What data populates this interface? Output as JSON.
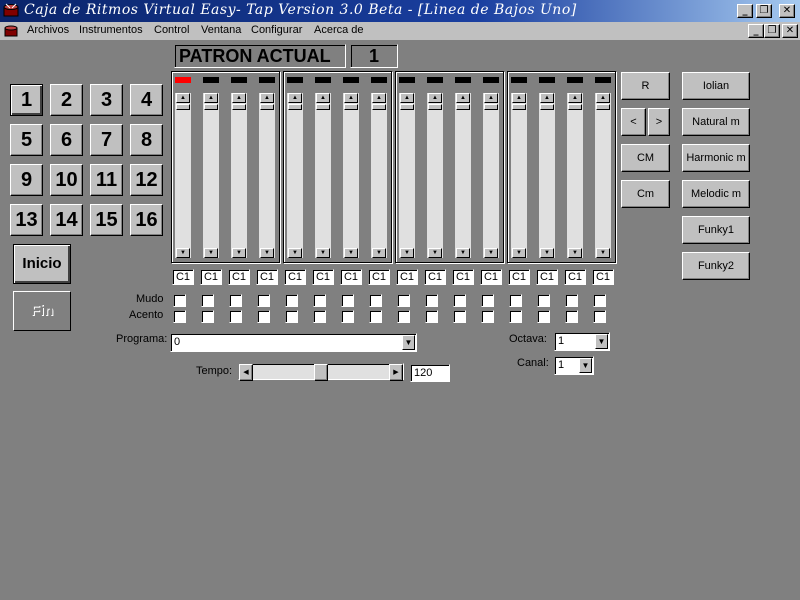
{
  "window": {
    "title": "Caja de Ritmos Virtual Easy- Tap Version 3.0 Beta - [Linea de Bajos Uno]",
    "app_icon": "drum-icon",
    "caption_buttons": [
      "_",
      "❐",
      "✕"
    ],
    "mdi_buttons": [
      "_",
      "❐",
      "✕"
    ]
  },
  "menu": [
    "Archivos",
    "Instrumentos",
    "Control",
    "Ventana",
    "Configurar",
    "Acerca de"
  ],
  "patron": {
    "label": "PATRON ACTUAL",
    "value": "1"
  },
  "pattern_buttons": [
    "1",
    "2",
    "3",
    "4",
    "5",
    "6",
    "7",
    "8",
    "9",
    "10",
    "11",
    "12",
    "13",
    "14",
    "15",
    "16"
  ],
  "selected_pattern": "1",
  "inicio_label": "Inicio",
  "fin_label": "Fin",
  "steps": {
    "count": 16,
    "active_led": 1,
    "notes": [
      "C1",
      "C1",
      "C1",
      "C1",
      "C1",
      "C1",
      "C1",
      "C1",
      "C1",
      "C1",
      "C1",
      "C1",
      "C1",
      "C1",
      "C1",
      "C1"
    ],
    "slider_level": 1.0
  },
  "mudo_label": "Mudo",
  "acento_label": "Acento",
  "programa": {
    "label": "Programa:",
    "value": "0"
  },
  "tempo": {
    "label": "Tempo:",
    "value": "120",
    "level": 0.5
  },
  "octava": {
    "label": "Octava:",
    "value": "1"
  },
  "canal": {
    "label": "Canal:",
    "value": "1"
  },
  "control_buttons": {
    "r": "R",
    "prev": "<",
    "next": ">",
    "cm_major": "CM",
    "cm_minor": "Cm"
  },
  "scale_buttons": [
    "Iolian",
    "Natural m",
    "Harmonic m",
    "Melodic m",
    "Funky1",
    "Funky2"
  ]
}
